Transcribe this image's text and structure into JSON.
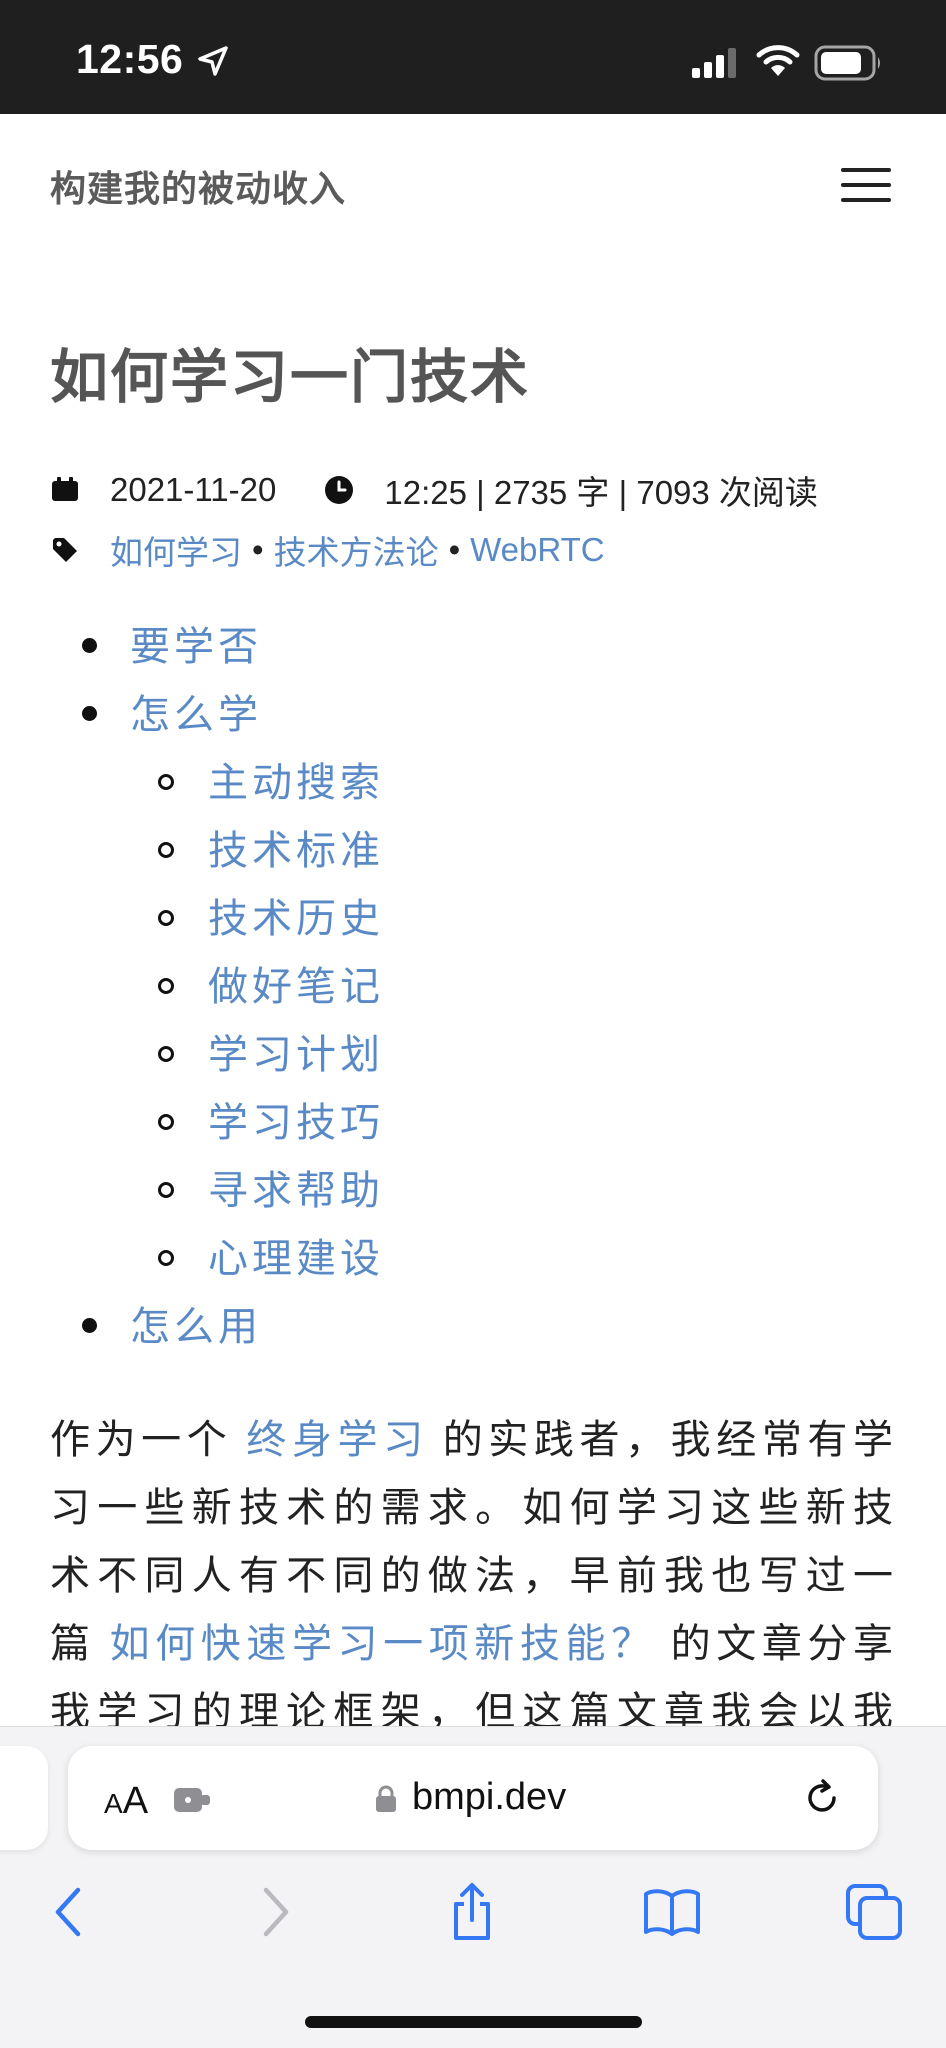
{
  "status_bar": {
    "time": "12:56"
  },
  "site": {
    "title": "构建我的被动收入"
  },
  "post": {
    "title": "如何学习一门技术",
    "date": "2021-11-20",
    "time_stats": "12:25 | 2735 字 | 7093 次阅读",
    "tags": [
      "如何学习",
      "技术方法论",
      "WebRTC"
    ],
    "tag_separator": "•"
  },
  "toc": {
    "items": [
      {
        "label": "要学否"
      },
      {
        "label": "怎么学"
      },
      {
        "label": "主动搜索"
      },
      {
        "label": "技术标准"
      },
      {
        "label": "技术历史"
      },
      {
        "label": "做好笔记"
      },
      {
        "label": "学习计划"
      },
      {
        "label": "学习技巧"
      },
      {
        "label": "寻求帮助"
      },
      {
        "label": "心理建设"
      },
      {
        "label": "怎么用"
      }
    ]
  },
  "paragraph": {
    "line1_a": "作为一个",
    "link1": "终身学习",
    "line1_b": "的实践者，我经常有学",
    "line2": "习一些新技术的需求。如何学习这些新技",
    "line3": "术不同人有不同的做法，早前我也写过一",
    "line4_a": "篇",
    "link2": "如何快速学习一项新技能？",
    "line4_b": "的文章分享",
    "line5": "我学习的理论框架，但这篇文章我会以我"
  },
  "browser": {
    "aa_small": "A",
    "aa_big": "A",
    "address": "bmpi.dev"
  },
  "colors": {
    "link": "#5a8ac6",
    "status_bar_bg": "#1f1f1f",
    "toolbar_icon": "#3478f6"
  },
  "icons": {
    "calendar": "calendar-icon",
    "clock": "clock-icon",
    "tag": "tag-icon",
    "menu": "hamburger-menu-icon",
    "back": "chevron-left-icon",
    "forward": "chevron-right-icon",
    "share": "share-icon",
    "bookmarks": "book-icon",
    "tabs": "tabs-icon"
  }
}
